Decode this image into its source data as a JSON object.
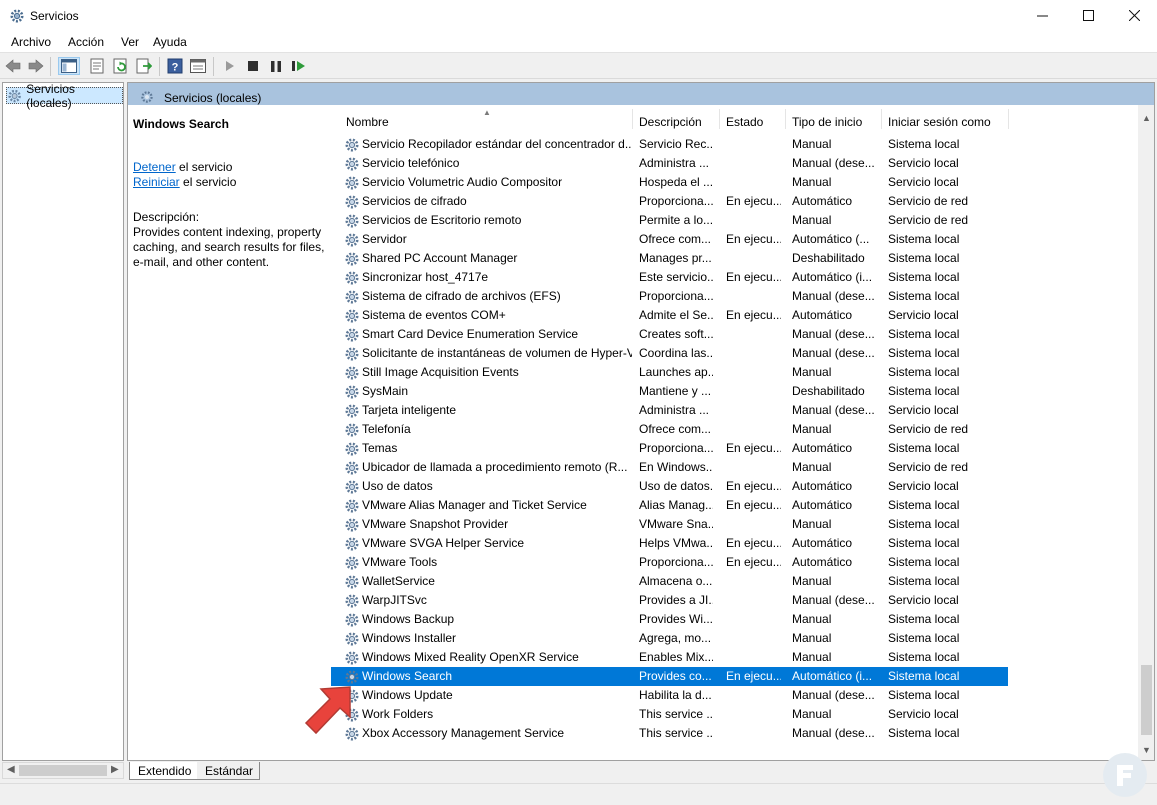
{
  "window": {
    "title": "Servicios"
  },
  "menu": [
    "Archivo",
    "Acción",
    "Ver",
    "Ayuda"
  ],
  "tree": {
    "root_label": "Servicios (locales)"
  },
  "content_header": "Servicios (locales)",
  "details": {
    "service_title": "Windows Search",
    "stop_link": "Detener",
    "stop_suffix": " el servicio",
    "restart_link": "Reiniciar",
    "restart_suffix": " el servicio",
    "description_label": "Descripción:",
    "description_text": "Provides content indexing, property caching, and search results for files, e-mail, and other content."
  },
  "columns": [
    "Nombre",
    "Descripción",
    "Estado",
    "Tipo de inicio",
    "Iniciar sesión como"
  ],
  "rows": [
    {
      "name": "Servicio Recopilador estándar del concentrador d...",
      "desc": "Servicio Rec...",
      "state": "",
      "start": "Manual",
      "logon": "Sistema local"
    },
    {
      "name": "Servicio telefónico",
      "desc": "Administra ...",
      "state": "",
      "start": "Manual (dese...",
      "logon": "Servicio local"
    },
    {
      "name": "Servicio Volumetric Audio Compositor",
      "desc": "Hospeda el ...",
      "state": "",
      "start": "Manual",
      "logon": "Servicio local"
    },
    {
      "name": "Servicios de cifrado",
      "desc": "Proporciona...",
      "state": "En ejecu...",
      "start": "Automático",
      "logon": "Servicio de red"
    },
    {
      "name": "Servicios de Escritorio remoto",
      "desc": "Permite a lo...",
      "state": "",
      "start": "Manual",
      "logon": "Servicio de red"
    },
    {
      "name": "Servidor",
      "desc": "Ofrece com...",
      "state": "En ejecu...",
      "start": "Automático (...",
      "logon": "Sistema local"
    },
    {
      "name": "Shared PC Account Manager",
      "desc": "Manages pr...",
      "state": "",
      "start": "Deshabilitado",
      "logon": "Sistema local"
    },
    {
      "name": "Sincronizar host_4717e",
      "desc": "Este servicio...",
      "state": "En ejecu...",
      "start": "Automático (i...",
      "logon": "Sistema local"
    },
    {
      "name": "Sistema de cifrado de archivos (EFS)",
      "desc": "Proporciona...",
      "state": "",
      "start": "Manual (dese...",
      "logon": "Sistema local"
    },
    {
      "name": "Sistema de eventos COM+",
      "desc": "Admite el Se...",
      "state": "En ejecu...",
      "start": "Automático",
      "logon": "Servicio local"
    },
    {
      "name": "Smart Card Device Enumeration Service",
      "desc": "Creates soft...",
      "state": "",
      "start": "Manual (dese...",
      "logon": "Sistema local"
    },
    {
      "name": "Solicitante de instantáneas de volumen de Hyper-V",
      "desc": "Coordina las...",
      "state": "",
      "start": "Manual (dese...",
      "logon": "Sistema local"
    },
    {
      "name": "Still Image Acquisition Events",
      "desc": "Launches ap...",
      "state": "",
      "start": "Manual",
      "logon": "Sistema local"
    },
    {
      "name": "SysMain",
      "desc": "Mantiene y ...",
      "state": "",
      "start": "Deshabilitado",
      "logon": "Sistema local"
    },
    {
      "name": "Tarjeta inteligente",
      "desc": "Administra ...",
      "state": "",
      "start": "Manual (dese...",
      "logon": "Servicio local"
    },
    {
      "name": "Telefonía",
      "desc": "Ofrece com...",
      "state": "",
      "start": "Manual",
      "logon": "Servicio de red"
    },
    {
      "name": "Temas",
      "desc": "Proporciona...",
      "state": "En ejecu...",
      "start": "Automático",
      "logon": "Sistema local"
    },
    {
      "name": "Ubicador de llamada a procedimiento remoto (R...",
      "desc": "En Windows...",
      "state": "",
      "start": "Manual",
      "logon": "Servicio de red"
    },
    {
      "name": "Uso de datos",
      "desc": "Uso de datos...",
      "state": "En ejecu...",
      "start": "Automático",
      "logon": "Servicio local"
    },
    {
      "name": "VMware Alias Manager and Ticket Service",
      "desc": "Alias Manag...",
      "state": "En ejecu...",
      "start": "Automático",
      "logon": "Sistema local"
    },
    {
      "name": "VMware Snapshot Provider",
      "desc": "VMware Sna...",
      "state": "",
      "start": "Manual",
      "logon": "Sistema local"
    },
    {
      "name": "VMware SVGA Helper Service",
      "desc": "Helps VMwa...",
      "state": "En ejecu...",
      "start": "Automático",
      "logon": "Sistema local"
    },
    {
      "name": "VMware Tools",
      "desc": "Proporciona...",
      "state": "En ejecu...",
      "start": "Automático",
      "logon": "Sistema local"
    },
    {
      "name": "WalletService",
      "desc": "Almacena o...",
      "state": "",
      "start": "Manual",
      "logon": "Sistema local"
    },
    {
      "name": "WarpJITSvc",
      "desc": "Provides a JI...",
      "state": "",
      "start": "Manual (dese...",
      "logon": "Servicio local"
    },
    {
      "name": "Windows Backup",
      "desc": "Provides Wi...",
      "state": "",
      "start": "Manual",
      "logon": "Sistema local"
    },
    {
      "name": "Windows Installer",
      "desc": "Agrega, mo...",
      "state": "",
      "start": "Manual",
      "logon": "Sistema local"
    },
    {
      "name": "Windows Mixed Reality OpenXR Service",
      "desc": "Enables Mix...",
      "state": "",
      "start": "Manual",
      "logon": "Sistema local"
    },
    {
      "name": "Windows Search",
      "desc": "Provides co...",
      "state": "En ejecu...",
      "start": "Automático (i...",
      "logon": "Sistema local",
      "selected": true
    },
    {
      "name": "Windows Update",
      "desc": "Habilita la d...",
      "state": "",
      "start": "Manual (dese...",
      "logon": "Sistema local"
    },
    {
      "name": "Work Folders",
      "desc": "This service ...",
      "state": "",
      "start": "Manual",
      "logon": "Servicio local"
    },
    {
      "name": "Xbox Accessory Management Service",
      "desc": "This service ...",
      "state": "",
      "start": "Manual (dese...",
      "logon": "Sistema local"
    }
  ],
  "tabs": [
    "Extendido",
    "Estándar"
  ],
  "colors": {
    "selection": "#0078d7",
    "header_band": "#a9c3de",
    "link": "#0066cc",
    "pointer_arrow": "#e8433c"
  },
  "icons": {
    "titlebar": "gear-icon",
    "service": "gear-icon",
    "window_controls": [
      "minimize-icon",
      "maximize-icon",
      "close-icon"
    ],
    "toolbar": [
      "back-icon",
      "forward-icon",
      "show-hide-tree-icon",
      "properties-icon",
      "refresh-icon",
      "export-list-icon",
      "help-icon",
      "view-icon",
      "start-service-icon",
      "stop-service-icon",
      "pause-service-icon",
      "restart-service-icon"
    ]
  }
}
